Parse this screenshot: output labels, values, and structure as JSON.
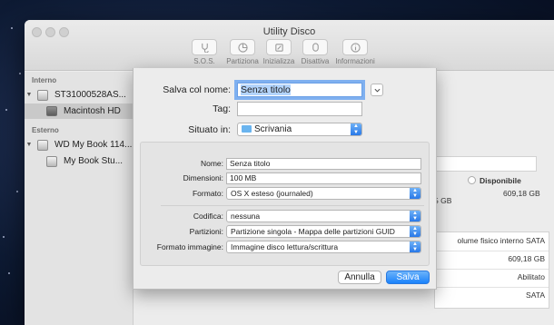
{
  "window": {
    "title": "Utility Disco"
  },
  "toolbar": [
    {
      "label": "S.O.S.",
      "icon": "stethoscope-icon"
    },
    {
      "label": "Partiziona",
      "icon": "pie-icon"
    },
    {
      "label": "Inizializza",
      "icon": "eraser-icon"
    },
    {
      "label": "Disattiva",
      "icon": "eject-icon"
    },
    {
      "label": "Informazioni",
      "icon": "info-icon"
    }
  ],
  "sidebar": {
    "internal_header": "Interno",
    "external_header": "Esterno",
    "items": [
      {
        "label": "ST31000528AS..."
      },
      {
        "label": "Macintosh HD"
      },
      {
        "label": "WD My Book 114..."
      },
      {
        "label": "My Book Stu..."
      }
    ]
  },
  "background": {
    "available_label": "Disponibile",
    "available_left": "5 GB",
    "available_value": "609,18 GB",
    "info_rows": [
      "olume fisico interno SATA",
      "609,18 GB",
      "Abilitato",
      "SATA"
    ]
  },
  "sheet": {
    "save_as_label": "Salva col nome:",
    "save_as_value": "Senza titolo",
    "tags_label": "Tag:",
    "tags_value": "",
    "where_label": "Situato in:",
    "where_value": "Scrivania",
    "name_label": "Nome:",
    "name_value": "Senza titolo",
    "size_label": "Dimensioni:",
    "size_value": "100 MB",
    "format_label": "Formato:",
    "format_value": "OS X esteso (journaled)",
    "encryption_label": "Codifica:",
    "encryption_value": "nessuna",
    "partitions_label": "Partizioni:",
    "partitions_value": "Partizione singola - Mappa delle partizioni GUID",
    "image_format_label": "Formato immagine:",
    "image_format_value": "Immagine disco lettura/scrittura",
    "cancel_label": "Annulla",
    "save_label": "Salva"
  }
}
